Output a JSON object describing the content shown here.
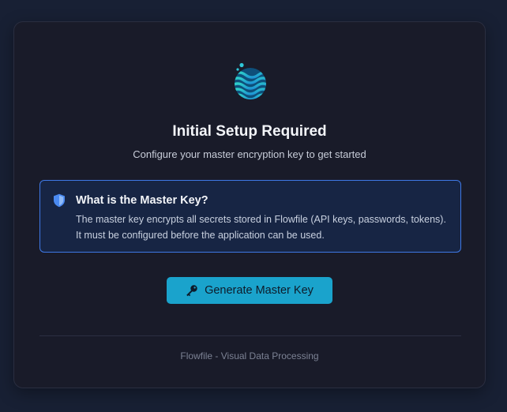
{
  "header": {
    "logo_icon": "wave-logo-icon",
    "title": "Initial Setup Required",
    "subtitle": "Configure your master encryption key to get started"
  },
  "info": {
    "icon": "shield-icon",
    "title": "What is the Master Key?",
    "text": "The master key encrypts all secrets stored in Flowfile (API keys, passwords, tokens). It must be configured before the application can be used."
  },
  "actions": {
    "generate_icon": "key-icon",
    "generate_label": "Generate Master Key"
  },
  "footer": {
    "text": "Flowfile - Visual Data Processing"
  },
  "colors": {
    "background": "#182034",
    "card": "#191b29",
    "accent": "#1aa3cc",
    "info_border": "#3f79e6",
    "info_bg": "#172544"
  }
}
